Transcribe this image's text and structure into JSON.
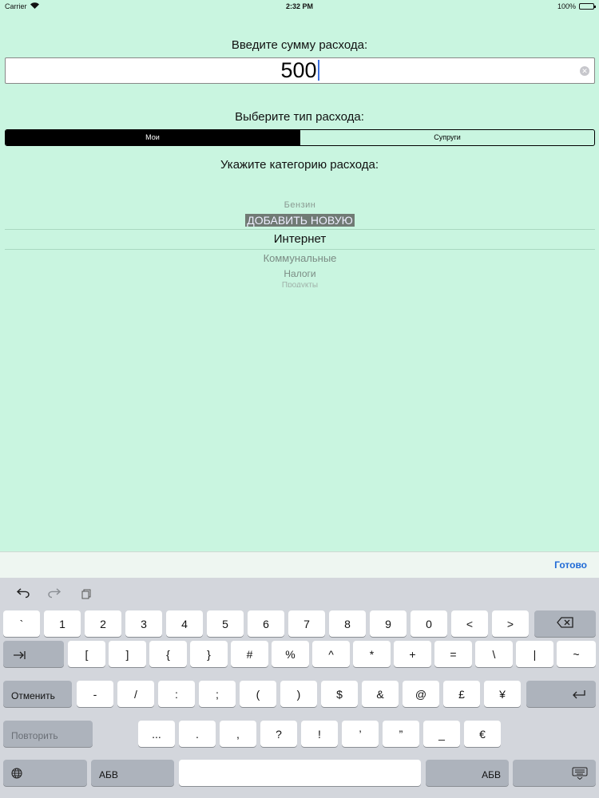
{
  "status_bar": {
    "carrier": "Carrier",
    "time": "2:32 PM",
    "battery": "100%"
  },
  "form": {
    "amount_label": "Введите сумму расхода:",
    "amount_value": "500",
    "type_label": "Выберите тип расхода:",
    "segments": [
      "Мои",
      "Супруги"
    ],
    "selected_segment": "Мои",
    "category_label": "Укажите категорию расхода:"
  },
  "picker": {
    "items": [
      "Бензин",
      "ДОБАВИТЬ НОВУЮ",
      "Интернет",
      "Коммунальные",
      "Налоги",
      "Продукты"
    ],
    "selected": "Интернет"
  },
  "accessory": {
    "done": "Готово"
  },
  "keyboard": {
    "toolbar": [
      "undo-icon",
      "redo-icon",
      "paste-icon"
    ],
    "row1": [
      "`",
      "1",
      "2",
      "3",
      "4",
      "5",
      "6",
      "7",
      "8",
      "9",
      "0",
      "<",
      ">"
    ],
    "row2": [
      "[",
      "]",
      "{",
      "}",
      "#",
      "%",
      "^",
      "*",
      "+",
      "=",
      "\\",
      "|",
      "~"
    ],
    "row3": [
      "-",
      "/",
      ":",
      ";",
      "(",
      ")",
      "$",
      "&",
      "@",
      "£",
      "¥"
    ],
    "row4": [
      "...",
      ".",
      ",",
      "?",
      "!",
      "’",
      "”",
      "_",
      "€"
    ],
    "undo_label": "Отменить",
    "redo_label": "Повторить",
    "abc_left": "АБВ",
    "abc_right": "АБВ"
  }
}
